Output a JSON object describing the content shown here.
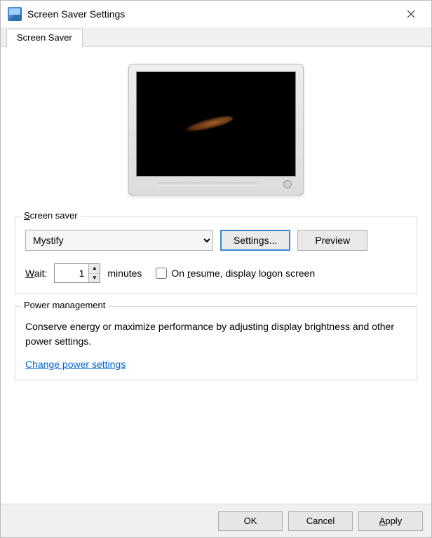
{
  "window": {
    "title": "Screen Saver Settings"
  },
  "tabs": [
    {
      "label": "Screen Saver"
    }
  ],
  "screensaver_group": {
    "label": "Screen saver",
    "selected": "Mystify",
    "settings_button": "Settings...",
    "preview_button": "Preview",
    "wait_label": "Wait:",
    "wait_value": "1",
    "wait_units": "minutes",
    "resume_checkbox_label": "On resume, display logon screen",
    "resume_checked": false
  },
  "power_group": {
    "label": "Power management",
    "description": "Conserve energy or maximize performance by adjusting display brightness and other power settings.",
    "link": "Change power settings"
  },
  "footer": {
    "ok": "OK",
    "cancel": "Cancel",
    "apply": "Apply"
  }
}
